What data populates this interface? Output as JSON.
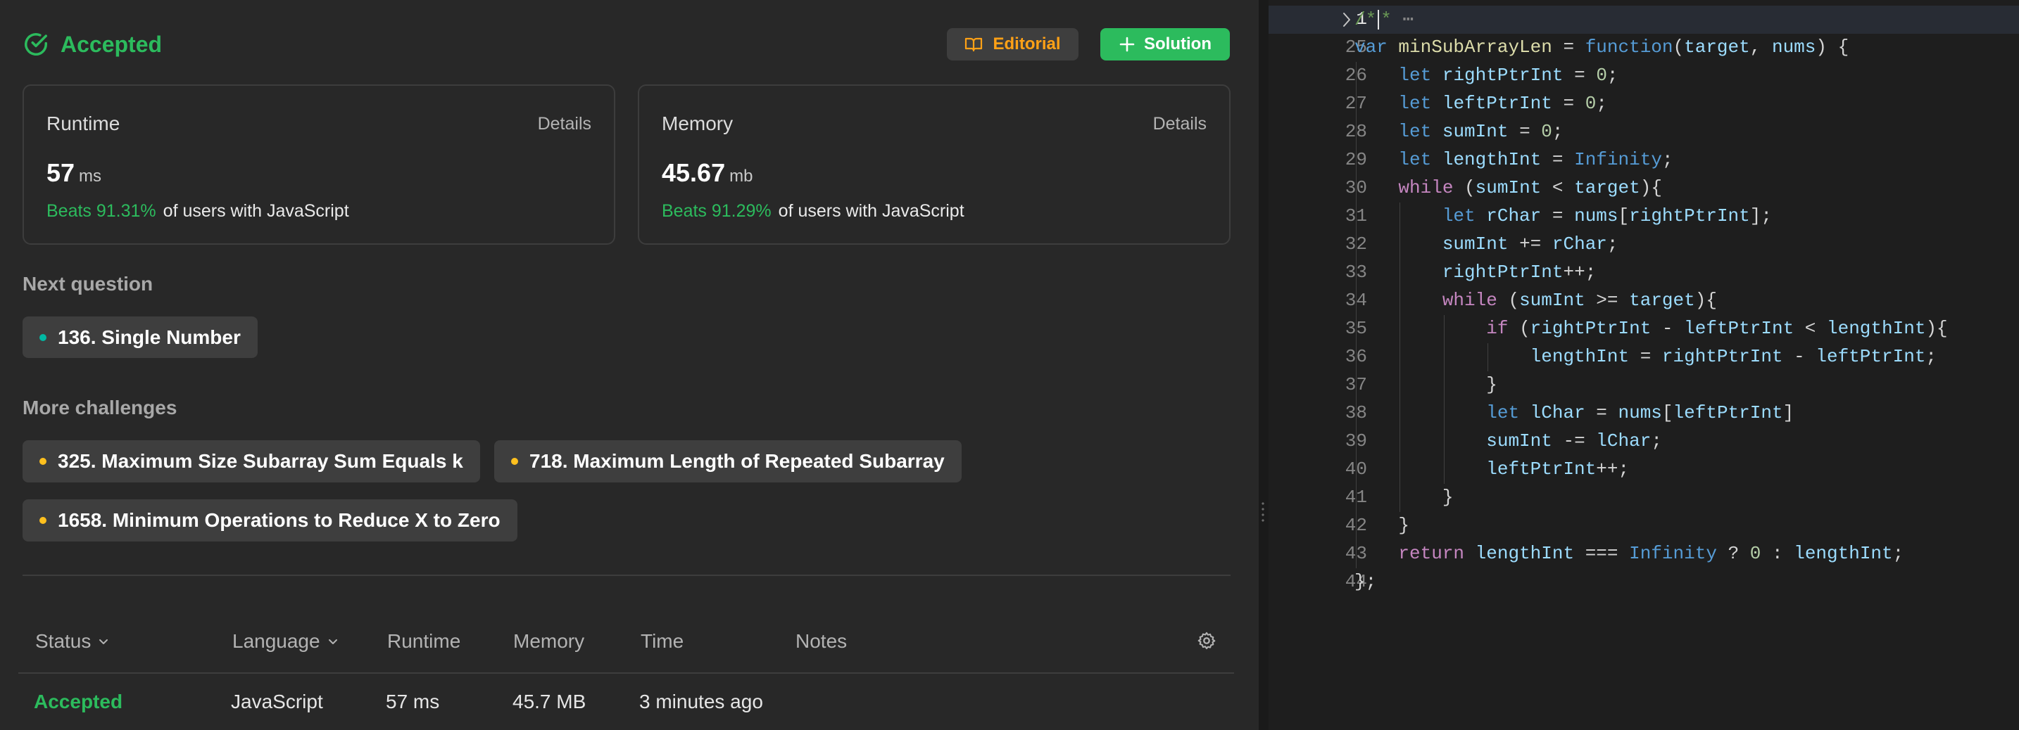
{
  "result": {
    "status": "Accepted",
    "editorial_label": "Editorial",
    "solution_label": "Solution"
  },
  "runtime_card": {
    "label": "Runtime",
    "details": "Details",
    "value": "57",
    "unit": "ms",
    "beats_pct": "Beats 91.31%",
    "beats_text": "of users with JavaScript"
  },
  "memory_card": {
    "label": "Memory",
    "details": "Details",
    "value": "45.67",
    "unit": "mb",
    "beats_pct": "Beats 91.29%",
    "beats_text": "of users with JavaScript"
  },
  "next_question": {
    "title": "Next question",
    "item": {
      "label": "136. Single Number",
      "difficulty_color": "#00b8a3"
    }
  },
  "more_challenges": {
    "title": "More challenges",
    "items": [
      {
        "label": "325. Maximum Size Subarray Sum Equals k",
        "difficulty_color": "#ffc01e"
      },
      {
        "label": "718. Maximum Length of Repeated Subarray",
        "difficulty_color": "#ffc01e"
      },
      {
        "label": "1658. Minimum Operations to Reduce X to Zero",
        "difficulty_color": "#ffc01e"
      }
    ]
  },
  "submissions": {
    "headers": [
      "Status",
      "Language",
      "Runtime",
      "Memory",
      "Time",
      "Notes"
    ],
    "row": {
      "status": "Accepted",
      "language": "JavaScript",
      "runtime": "57 ms",
      "memory": "45.7 MB",
      "time": "3 minutes ago",
      "notes": ""
    }
  },
  "editor": {
    "line_numbers": [
      "1",
      "25",
      "26",
      "27",
      "28",
      "29",
      "30",
      "31",
      "32",
      "33",
      "34",
      "35",
      "36",
      "37",
      "38",
      "39",
      "40",
      "41",
      "42",
      "43",
      "44"
    ],
    "lines": [
      "/**",
      "var minSubArrayLen = function(target, nums) {",
      "    let rightPtrInt = 0;",
      "    let leftPtrInt = 0;",
      "    let sumInt = 0;",
      "    let lengthInt = Infinity;",
      "    while (sumInt < target){",
      "        let rChar = nums[rightPtrInt];",
      "        sumInt += rChar;",
      "        rightPtrInt++;",
      "        while (sumInt >= target){",
      "            if (rightPtrInt - leftPtrInt < lengthInt){",
      "                lengthInt = rightPtrInt - leftPtrInt;",
      "            }",
      "            let lChar = nums[leftPtrInt]",
      "            sumInt -= lChar;",
      "            leftPtrInt++;",
      "        }",
      "    }",
      "    return lengthInt === Infinity ? 0 : lengthInt;",
      "};"
    ],
    "fold_ellipsis": "⋯"
  },
  "colors": {
    "accent_green": "#2cbb5d",
    "editorial_orange": "#ffa116",
    "easy": "#00b8a3",
    "medium": "#ffc01e"
  }
}
